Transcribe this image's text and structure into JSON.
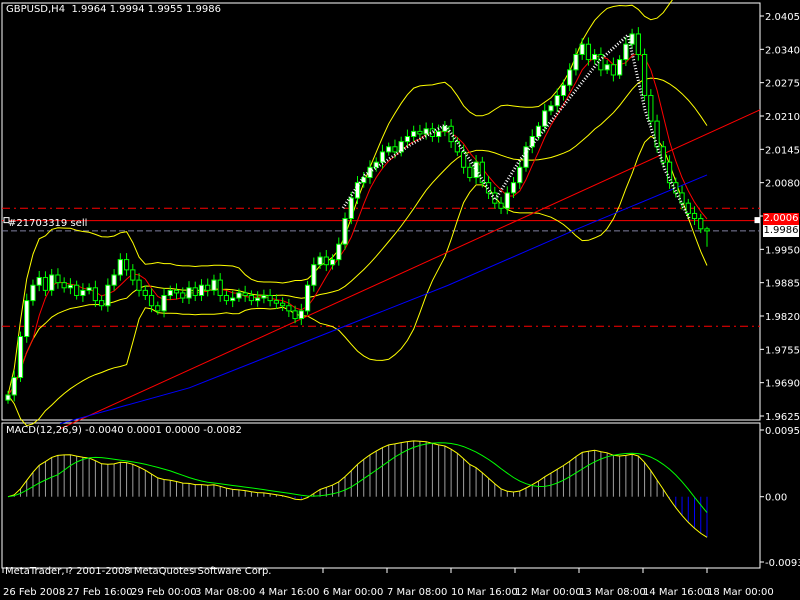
{
  "header": {
    "symbol_timeframe": "GBPUSD,H4",
    "ohlc": "1.9964 1.9994 1.9955 1.9986"
  },
  "order": {
    "label": "#21703319 sell",
    "price": "2.0006"
  },
  "bid": "1.9986",
  "macd": {
    "title": "MACD(12,26,9) -0.0040 0.0001 0.0000 -0.0082"
  },
  "copyright": "MetaTrader, ? 2001-2008 MetaQuotes Software Corp.",
  "colors": {
    "background": "#000000",
    "candle_outline": "#00ff00",
    "bull_fill": "#ffffff",
    "bear_fill": "#000000",
    "bollinger": "#ffff00",
    "ma_fast": "#ff0000",
    "ma_slow_red": "#ff0000",
    "ma_slow_blue": "#0000ff",
    "macd_hist_pos": "#a0a0a0",
    "macd_hist_neg": "#0000ff",
    "macd_line": "#ffff00",
    "signal_line": "#00ff00",
    "order_line": "#ff0000"
  },
  "chart_data": [
    {
      "type": "candlestick",
      "title": "GBPUSD,H4",
      "ylim": [
        1.9625,
        2.0405
      ],
      "y_ticks": [
        "2.0405",
        "2.0340",
        "2.0275",
        "2.0210",
        "2.0145",
        "2.0080",
        "2.0015",
        "1.9950",
        "1.9885",
        "1.9820",
        "1.9755",
        "1.9690",
        "1.9625"
      ],
      "x_ticks": [
        "26 Feb 2008",
        "27 Feb 16:00",
        "29 Feb 00:00",
        "3 Mar 08:00",
        "4 Mar 16:00",
        "6 Mar 00:00",
        "7 Mar 08:00",
        "10 Mar 16:00",
        "12 Mar 00:00",
        "13 Mar 08:00",
        "14 Mar 16:00",
        "18 Mar 00:00"
      ],
      "closes": [
        1.9666,
        1.97,
        1.978,
        1.985,
        1.988,
        1.9895,
        1.987,
        1.99,
        1.9885,
        1.9875,
        1.988,
        1.986,
        1.987,
        1.9875,
        1.985,
        1.984,
        1.988,
        1.99,
        1.993,
        1.991,
        1.989,
        1.987,
        1.986,
        1.984,
        1.983,
        1.986,
        1.987,
        1.9865,
        1.9855,
        1.9875,
        1.986,
        1.988,
        1.987,
        1.989,
        1.986,
        1.985,
        1.9855,
        1.9865,
        1.986,
        1.985,
        1.9855,
        1.986,
        1.985,
        1.9845,
        1.984,
        1.983,
        1.9815,
        1.983,
        1.988,
        1.992,
        1.9935,
        1.992,
        1.993,
        1.996,
        2.001,
        2.005,
        2.008,
        2.009,
        2.011,
        2.012,
        2.014,
        2.015,
        2.014,
        2.016,
        2.017,
        2.018,
        2.0175,
        2.0185,
        2.017,
        2.018,
        2.019,
        2.016,
        2.014,
        2.011,
        2.009,
        2.012,
        2.008,
        2.006,
        2.004,
        2.003,
        2.006,
        2.008,
        2.011,
        2.015,
        2.017,
        2.019,
        2.022,
        2.023,
        2.025,
        2.027,
        2.03,
        2.033,
        2.035,
        2.032,
        2.033,
        2.03,
        2.031,
        2.029,
        2.032,
        2.035,
        2.037,
        2.033,
        2.025,
        2.02,
        2.015,
        2.012,
        2.008,
        2.006,
        2.004,
        2.002,
        2.001,
        1.999,
        1.9986
      ],
      "last_candle": {
        "open": 1.9964,
        "high": 1.9994,
        "low": 1.9955,
        "close": 1.9986
      },
      "slow_ma_red": [
        1.96,
        2.0222
      ],
      "slow_ma_blue": [
        1.961,
        1.968,
        1.978,
        1.988,
        1.999,
        2.0095
      ],
      "horizontal_lines": [
        2.003,
        1.98
      ],
      "ask": 2.0006,
      "bid": 1.9986
    },
    {
      "type": "macd",
      "title": "MACD(12,26,9)",
      "values": {
        "main": -0.004,
        "signal": 0.0001,
        "value3": 0.0,
        "value4": -0.0082
      },
      "ylim": [
        -0.0093,
        0.0095
      ],
      "y_ticks": [
        "0.0095",
        "0.00",
        "-0.0093"
      ]
    }
  ]
}
